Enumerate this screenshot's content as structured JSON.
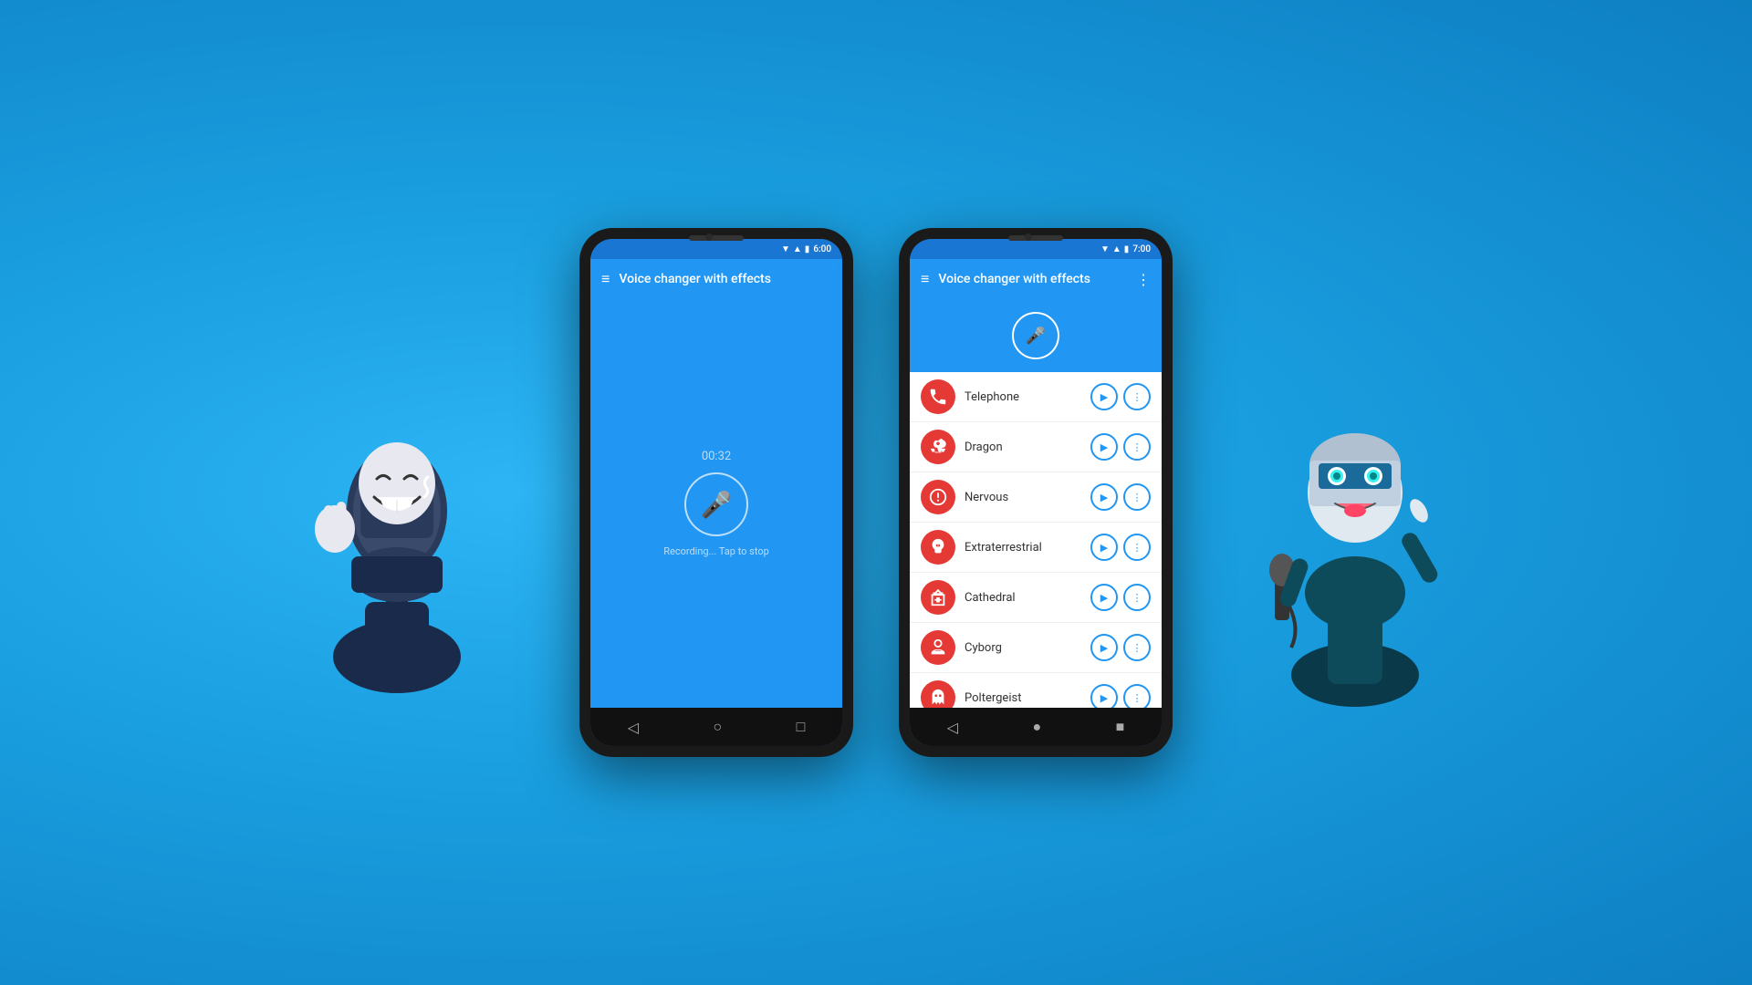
{
  "background": {
    "color": "#1a9fe0"
  },
  "phone1": {
    "status_bar": {
      "time": "6:00"
    },
    "app_bar": {
      "title": "Voice changer with effects",
      "menu_icon": "≡"
    },
    "screen": {
      "timer": "00:32",
      "recording_status": "Recording... Tap to stop"
    },
    "nav": {
      "back": "◁",
      "home": "○",
      "recent": "□"
    }
  },
  "phone2": {
    "status_bar": {
      "time": "7:00"
    },
    "app_bar": {
      "title": "Voice changer with effects",
      "menu_icon": "≡",
      "more_icon": "⋮"
    },
    "effects": [
      {
        "name": "Telephone",
        "icon": "phone"
      },
      {
        "name": "Dragon",
        "icon": "dragon"
      },
      {
        "name": "Nervous",
        "icon": "nervous"
      },
      {
        "name": "Extraterrestrial",
        "icon": "alien"
      },
      {
        "name": "Cathedral",
        "icon": "cathedral"
      },
      {
        "name": "Cyborg",
        "icon": "cyborg"
      },
      {
        "name": "Poltergeist",
        "icon": "ghost"
      }
    ],
    "nav": {
      "back": "◁",
      "home": "●",
      "recent": "■"
    }
  }
}
